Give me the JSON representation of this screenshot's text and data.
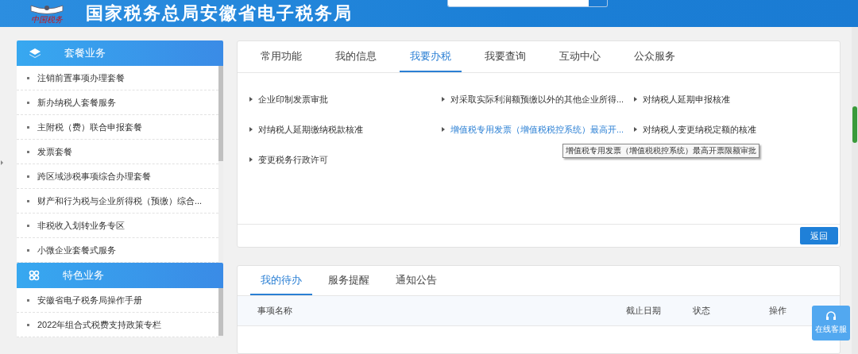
{
  "header": {
    "logo_text": "中国税务",
    "title": "国家税务总局安徽省电子税务局"
  },
  "sidebar": {
    "sections": [
      {
        "title": "套餐业务",
        "kind": "layers",
        "items": [
          "注销前置事项办理套餐",
          "新办纳税人套餐服务",
          "主附税（费）联合申报套餐",
          "发票套餐",
          "跨区域涉税事项综合办理套餐",
          "财产和行为税与企业所得税（预缴）综合...",
          "非税收入划转业务专区",
          "小微企业套餐式服务"
        ]
      },
      {
        "title": "特色业务",
        "kind": "clover",
        "items": [
          "安徽省电子税务局操作手册",
          "2022年组合式税费支持政策专栏"
        ]
      }
    ]
  },
  "main_panel": {
    "tabs": [
      {
        "label": "常用功能",
        "selected": false
      },
      {
        "label": "我的信息",
        "selected": false
      },
      {
        "label": "我要办税",
        "selected": true
      },
      {
        "label": "我要查询",
        "selected": false
      },
      {
        "label": "互动中心",
        "selected": false
      },
      {
        "label": "公众服务",
        "selected": false
      }
    ],
    "links": [
      {
        "label": "企业印制发票审批",
        "hovered": false
      },
      {
        "label": "对采取实际利润额预缴以外的其他企业所得...",
        "hovered": false
      },
      {
        "label": "对纳税人延期申报核准",
        "hovered": false
      },
      {
        "label": "对纳税人延期缴纳税款核准",
        "hovered": false
      },
      {
        "label": "增值税专用发票（增值税税控系统）最高开...",
        "hovered": true
      },
      {
        "label": "对纳税人变更纳税定额的核准",
        "hovered": false
      },
      {
        "label": "变更税务行政许可",
        "hovered": false
      }
    ],
    "tooltip": "增值税专用发票（增值税税控系统）最高开票限额审批",
    "back_button": "返回"
  },
  "todo_panel": {
    "tabs": [
      {
        "label": "我的待办",
        "selected": true
      },
      {
        "label": "服务提醒",
        "selected": false
      },
      {
        "label": "通知公告",
        "selected": false
      }
    ],
    "columns": [
      "事项名称",
      "截止日期",
      "状态",
      "操作"
    ]
  },
  "service_button": "在线客服"
}
